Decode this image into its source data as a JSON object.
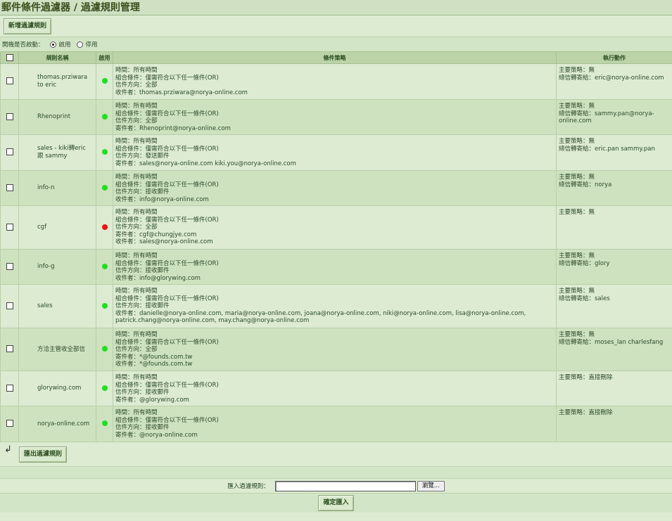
{
  "page": {
    "title": "郵件條件過濾器 / 過濾規則管理",
    "add_button": "新增過濾規則",
    "status_label": "開機是否啟動：",
    "status_on": "啟用",
    "status_off": "停用"
  },
  "table": {
    "headers": {
      "name": "規則名稱",
      "enabled": "啟用",
      "condition": "條件策略",
      "action": "執行動作"
    },
    "rows": [
      {
        "name": "thomas.prziwara to eric",
        "enabled": true,
        "cond": [
          "時間：所有時間",
          "組合條件：僅需符合以下任一條件(OR)",
          "信件方向：全部",
          "收件者：thomas.prziwara@norya-online.com"
        ],
        "action": [
          "主要策略：無",
          "總信轉寄給：eric@norya-online.com"
        ]
      },
      {
        "name": "Rhenoprint",
        "enabled": true,
        "cond": [
          "時間：所有時間",
          "組合條件：僅需符合以下任一條件(OR)",
          "信件方向：全部",
          "寄件者：Rhenoprint@norya-online.com"
        ],
        "action": [
          "主要策略：無",
          "總信轉寄給：sammy.pan@norya-online.com"
        ]
      },
      {
        "name": "sales - kiki轉eric 跟 sammy",
        "enabled": true,
        "cond": [
          "時間：所有時間",
          "組合條件：僅需符合以下任一條件(OR)",
          "信件方向：發送郵件",
          "寄件者：sales@norya-online.com kiki.you@norya-online.com"
        ],
        "action": [
          "主要策略：無",
          "總信轉寄給：eric.pan sammy.pan"
        ]
      },
      {
        "name": "info-n",
        "enabled": true,
        "cond": [
          "時間：所有時間",
          "組合條件：僅需符合以下任一條件(OR)",
          "信件方向：接收郵件",
          "收件者：info@norya-online.com"
        ],
        "action": [
          "主要策略：無",
          "總信轉寄給：norya"
        ]
      },
      {
        "name": "cgf",
        "enabled": false,
        "cond": [
          "時間：所有時間",
          "組合條件：僅需符合以下任一條件(OR)",
          "信件方向：全部",
          "寄件者：cgf@chungjye.com",
          "收件者：sales@norya-online.com"
        ],
        "action": [
          "主要策略：無"
        ]
      },
      {
        "name": "info-g",
        "enabled": true,
        "cond": [
          "時間：所有時間",
          "組合條件：僅需符合以下任一條件(OR)",
          "信件方向：接收郵件",
          "收件者：info@glorywing.com"
        ],
        "action": [
          "主要策略：無",
          "總信轉寄給：glory"
        ]
      },
      {
        "name": "sales",
        "enabled": true,
        "cond": [
          "時間：所有時間",
          "組合條件：僅需符合以下任一條件(OR)",
          "信件方向：接收郵件",
          "收件者：danielle@norya-online.com, maria@norya-online.com, joana@norya-online.com, niki@norya-online.com, lisa@norya-online.com, patrick.chang@norya-online.com, may.chang@norya-online.com"
        ],
        "action": [
          "主要策略：無",
          "總信轉寄給：sales"
        ]
      },
      {
        "name": "方洽主管收全部信",
        "enabled": true,
        "cond": [
          "時間：所有時間",
          "組合條件：僅需符合以下任一條件(OR)",
          "信件方向：全部",
          "寄件者：*@founds.com.tw",
          "收件者：*@founds.com.tw"
        ],
        "action": [
          "主要策略：無",
          "總信轉寄給：moses_lan charlesfang"
        ]
      },
      {
        "name": "glorywing.com",
        "enabled": true,
        "cond": [
          "時間：所有時間",
          "組合條件：僅需符合以下任一條件(OR)",
          "信件方向：接收郵件",
          "寄件者：@glorywing.com"
        ],
        "action": [
          "主要策略：直接刪除"
        ]
      },
      {
        "name": "norya-online.com",
        "enabled": true,
        "cond": [
          "時間：所有時間",
          "組合條件：僅需符合以下任一條件(OR)",
          "信件方向：接收郵件",
          "寄件者：@norya-online.com"
        ],
        "action": [
          "主要策略：直接刪除"
        ]
      }
    ]
  },
  "bottom": {
    "return_arrow": "↲",
    "export_button": "匯出過濾規則",
    "import_label": "匯入過濾規則：",
    "browse_button": "瀏覽...",
    "confirm_button": "確定匯入"
  },
  "colors": {
    "enabled_dot": "#22dd22",
    "disabled_dot": "#ee1111"
  }
}
